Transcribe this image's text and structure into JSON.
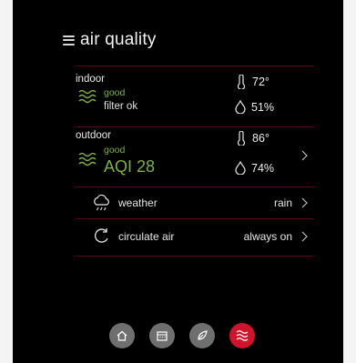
{
  "header": {
    "title": "air quality"
  },
  "indoor": {
    "label": "indoor",
    "status": "good",
    "detail": "filter ok",
    "temperature": "72°",
    "humidity": "51%"
  },
  "outdoor": {
    "label": "outdoor",
    "status": "good",
    "aqi": "AQI 28",
    "temperature": "86°",
    "humidity": "74%"
  },
  "weather": {
    "label": "weather",
    "value": "rain"
  },
  "circulate": {
    "label": "circulate air",
    "value": "always on"
  },
  "nav": {
    "items": [
      {
        "name": "home-icon"
      },
      {
        "name": "calendar-icon"
      },
      {
        "name": "leaf-icon"
      },
      {
        "name": "air-quality-icon",
        "active": true
      }
    ]
  },
  "colors": {
    "accent_red": "#d0142c",
    "divider_red": "#5a0b12",
    "good_green": "#7bb341",
    "nav_gray": "#6f6f6f"
  }
}
